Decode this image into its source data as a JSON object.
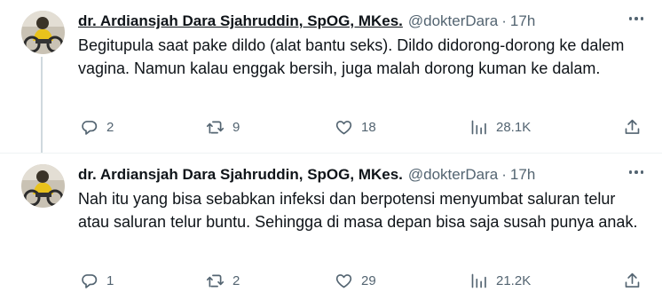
{
  "tweets": [
    {
      "author_name": "dr. Ardiansjah Dara Sjahruddin, SpOG, MKes.",
      "handle": "@dokterDara",
      "separator": "·",
      "time": "17h",
      "text": "Begitupula saat pake dildo (alat bantu seks). Dildo didorong-dorong ke dalem vagina. Namun kalau enggak bersih, juga malah dorong kuman ke dalam.",
      "replies": "2",
      "retweets": "9",
      "likes": "18",
      "views": "28.1K",
      "icons": {
        "more": "more-horizontal-icon",
        "reply": "reply-icon",
        "retweet": "retweet-icon",
        "like": "heart-icon",
        "views": "analytics-icon",
        "share": "share-icon"
      }
    },
    {
      "author_name": "dr. Ardiansjah Dara Sjahruddin, SpOG, MKes.",
      "handle": "@dokterDara",
      "separator": "·",
      "time": "17h",
      "text": "Nah itu yang bisa sebabkan infeksi dan berpotensi menyumbat saluran telur atau saluran telur buntu. Sehingga di masa depan bisa saja susah punya anak.",
      "replies": "1",
      "retweets": "2",
      "likes": "29",
      "views": "21.2K",
      "icons": {
        "more": "more-horizontal-icon",
        "reply": "reply-icon",
        "retweet": "retweet-icon",
        "like": "heart-icon",
        "views": "analytics-icon",
        "share": "share-icon"
      }
    }
  ],
  "colors": {
    "text": "#0f1419",
    "secondary": "#536471",
    "thread_line": "#cfd9de",
    "divider": "#eff3f4"
  }
}
